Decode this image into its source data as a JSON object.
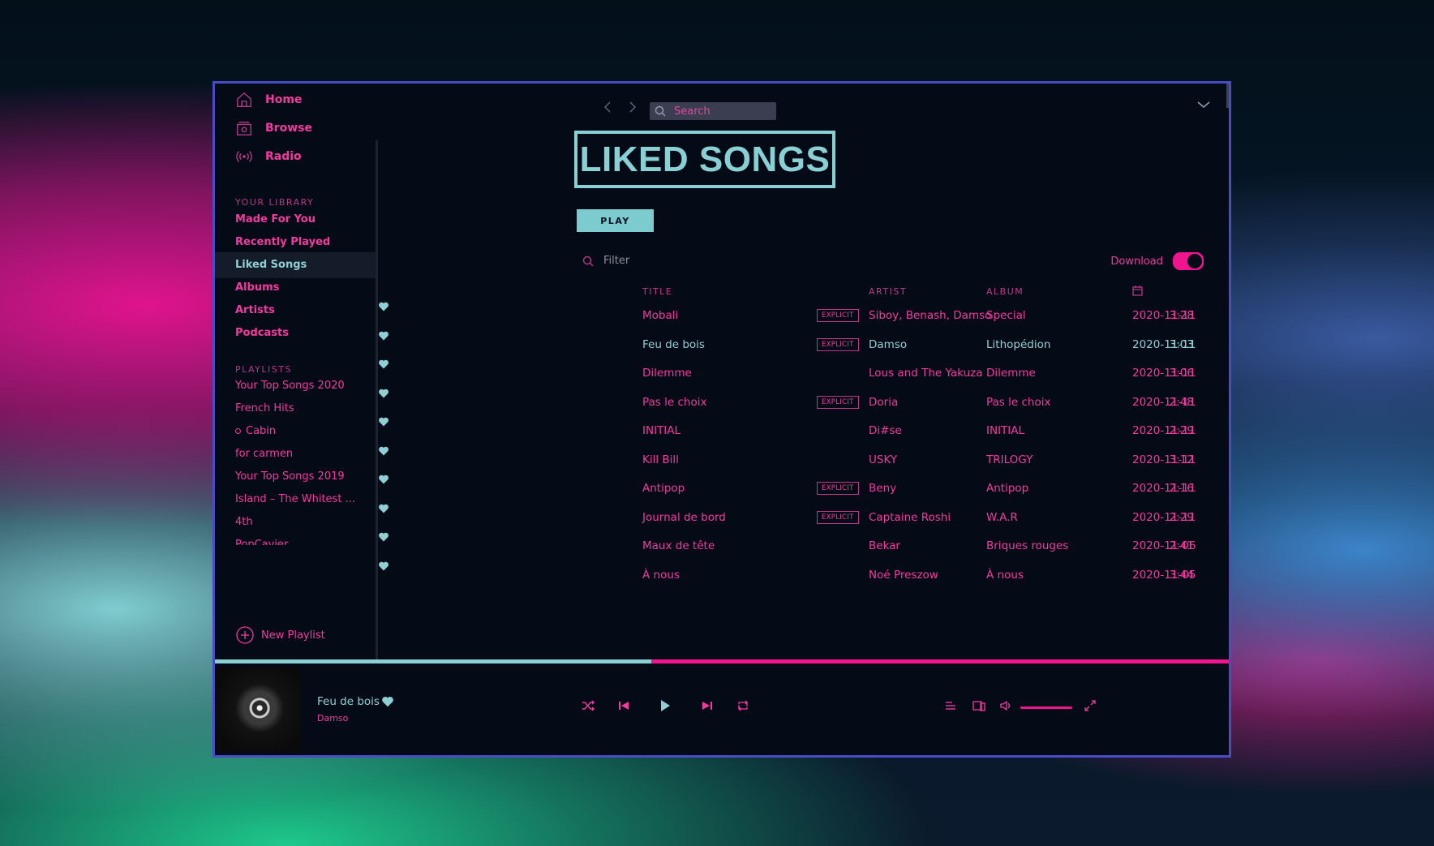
{
  "nav": {
    "home": "Home",
    "browse": "Browse",
    "radio": "Radio"
  },
  "library": {
    "label": "YOUR LIBRARY",
    "items": [
      "Made For You",
      "Recently Played",
      "Liked Songs",
      "Albums",
      "Artists",
      "Podcasts"
    ],
    "active": "Liked Songs"
  },
  "playlists": {
    "label": "PLAYLISTS",
    "items": [
      "Your Top Songs 2020",
      "French Hits",
      "Cabin",
      "for carmen",
      "Your Top Songs 2019",
      "Island – The Whitest ...",
      "4th",
      "PopCavier"
    ],
    "new_label": "New Playlist"
  },
  "search": {
    "placeholder": "Search"
  },
  "page": {
    "title": "LIKED SONGS",
    "play_label": "PLAY"
  },
  "filter": {
    "placeholder": "Filter"
  },
  "download": {
    "label": "Download",
    "enabled": true
  },
  "table": {
    "headers": {
      "title": "TITLE",
      "artist": "ARTIST",
      "album": "ALBUM",
      "date_icon": "calendar-icon",
      "duration_icon": "clock-icon"
    },
    "rows": [
      {
        "title": "Mobali",
        "explicit": "EXPLICIT",
        "artist": "Siboy, Benash, Damso",
        "album": "Special",
        "date": "2020-11-11",
        "duration": "3:28"
      },
      {
        "title": "Feu de bois",
        "explicit": "EXPLICIT",
        "artist": "Damso",
        "album": "Lithopédion",
        "date": "2020-11-11",
        "duration": "3:03",
        "current": true
      },
      {
        "title": "Dilemme",
        "explicit": "",
        "artist": "Lous and The Yakuza",
        "album": "Dilemme",
        "date": "2020-11-11",
        "duration": "3:06"
      },
      {
        "title": "Pas le choix",
        "explicit": "EXPLICIT",
        "artist": "Doria",
        "album": "Pas le choix",
        "date": "2020-11-11",
        "duration": "2:48"
      },
      {
        "title": "INITIAL",
        "explicit": "",
        "artist": "Di#se",
        "album": "INITIAL",
        "date": "2020-11-11",
        "duration": "2:29"
      },
      {
        "title": "Kill Bill",
        "explicit": "",
        "artist": "USKY",
        "album": "TRILOGY",
        "date": "2020-11-11",
        "duration": "3:12"
      },
      {
        "title": "Antipop",
        "explicit": "EXPLICIT",
        "artist": "Beny",
        "album": "Antipop",
        "date": "2020-11-11",
        "duration": "2:16"
      },
      {
        "title": "Journal de bord",
        "explicit": "EXPLICIT",
        "artist": "Captaine Roshi",
        "album": "W.A.R",
        "date": "2020-11-11",
        "duration": "2:29"
      },
      {
        "title": "Maux de tête",
        "explicit": "",
        "artist": "Bekar",
        "album": "Briques rouges",
        "date": "2020-11-06",
        "duration": "2:41"
      },
      {
        "title": "À nous",
        "explicit": "",
        "artist": "Noé Preszow",
        "album": "À nous",
        "date": "2020-11-05",
        "duration": "3:44"
      }
    ]
  },
  "now_playing": {
    "title": "Feu de bois",
    "artist": "Damso",
    "progress": 0.43,
    "volume": 1.0
  },
  "colors": {
    "accent_pink": "#f23a9f",
    "accent_teal": "#88d0d3",
    "background": "#050b16",
    "window_border": "#4a4cc2"
  }
}
